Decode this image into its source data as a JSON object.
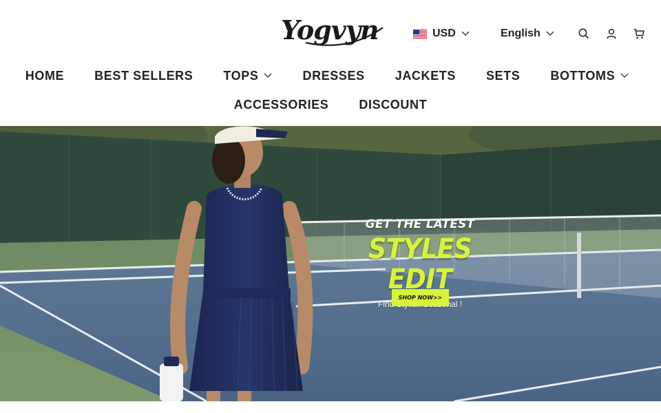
{
  "header": {
    "logo_text": "Yogvyn",
    "currency": {
      "label": "USD",
      "flag": "us-flag-icon"
    },
    "language": {
      "label": "English"
    },
    "icons": [
      "search-icon",
      "account-icon",
      "cart-icon"
    ]
  },
  "nav": {
    "row1": [
      {
        "label": "HOME",
        "has_dropdown": false
      },
      {
        "label": "BEST SELLERS",
        "has_dropdown": false
      },
      {
        "label": "TOPS",
        "has_dropdown": true
      },
      {
        "label": "DRESSES",
        "has_dropdown": false
      },
      {
        "label": "JACKETS",
        "has_dropdown": false
      },
      {
        "label": "SETS",
        "has_dropdown": false
      },
      {
        "label": "BOTTOMS",
        "has_dropdown": true
      }
    ],
    "row2": [
      {
        "label": "ACCESSORIES",
        "has_dropdown": false
      },
      {
        "label": "DISCOUNT",
        "has_dropdown": false
      }
    ]
  },
  "hero": {
    "kicker": "GET THE LATEST",
    "headline": "STYLES EDIT",
    "subtitle": "Find Stylish Seasonal !",
    "cta_label": "SHOP NOW>>"
  },
  "colors": {
    "accent_lime": "#d7f43a",
    "text_dark": "#222222",
    "court_blue": "#4e6a8c",
    "fence_green": "#2f4a3d",
    "dress_navy": "#1f2c5a"
  }
}
